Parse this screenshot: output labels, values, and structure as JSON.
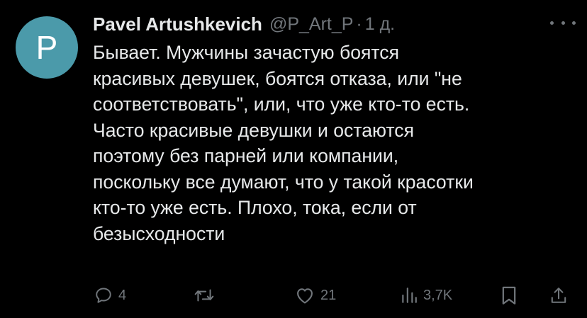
{
  "avatar": {
    "letter": "P",
    "color": "#4b9aaa"
  },
  "author": {
    "name": "Pavel Artushkevich",
    "handle": "@P_Art_P",
    "separator": "·",
    "timestamp": "1 д."
  },
  "body_lines": [
    "Бывает. Мужчины зачастую боятся",
    "красивых девушек, боятся отказа, или \"не",
    "соответствовать\", или, что уже кто-то есть.",
    "Часто красивые девушки и остаются",
    "поэтому без парней или компании,",
    "поскольку все думают, что у такой красотки",
    "кто-то уже есть. Плохо, тока, если от",
    "безысходности"
  ],
  "actions": {
    "reply_count": "4",
    "like_count": "21",
    "views_count": "3,7K"
  },
  "icons": {
    "reply": "reply-icon",
    "retweet": "retweet-icon",
    "like": "heart-icon",
    "views": "views-icon",
    "bookmark": "bookmark-icon",
    "share": "share-icon",
    "more": "more-icon"
  },
  "colors": {
    "background": "#000000",
    "text": "#e7e9ea",
    "secondary": "#71767b"
  }
}
